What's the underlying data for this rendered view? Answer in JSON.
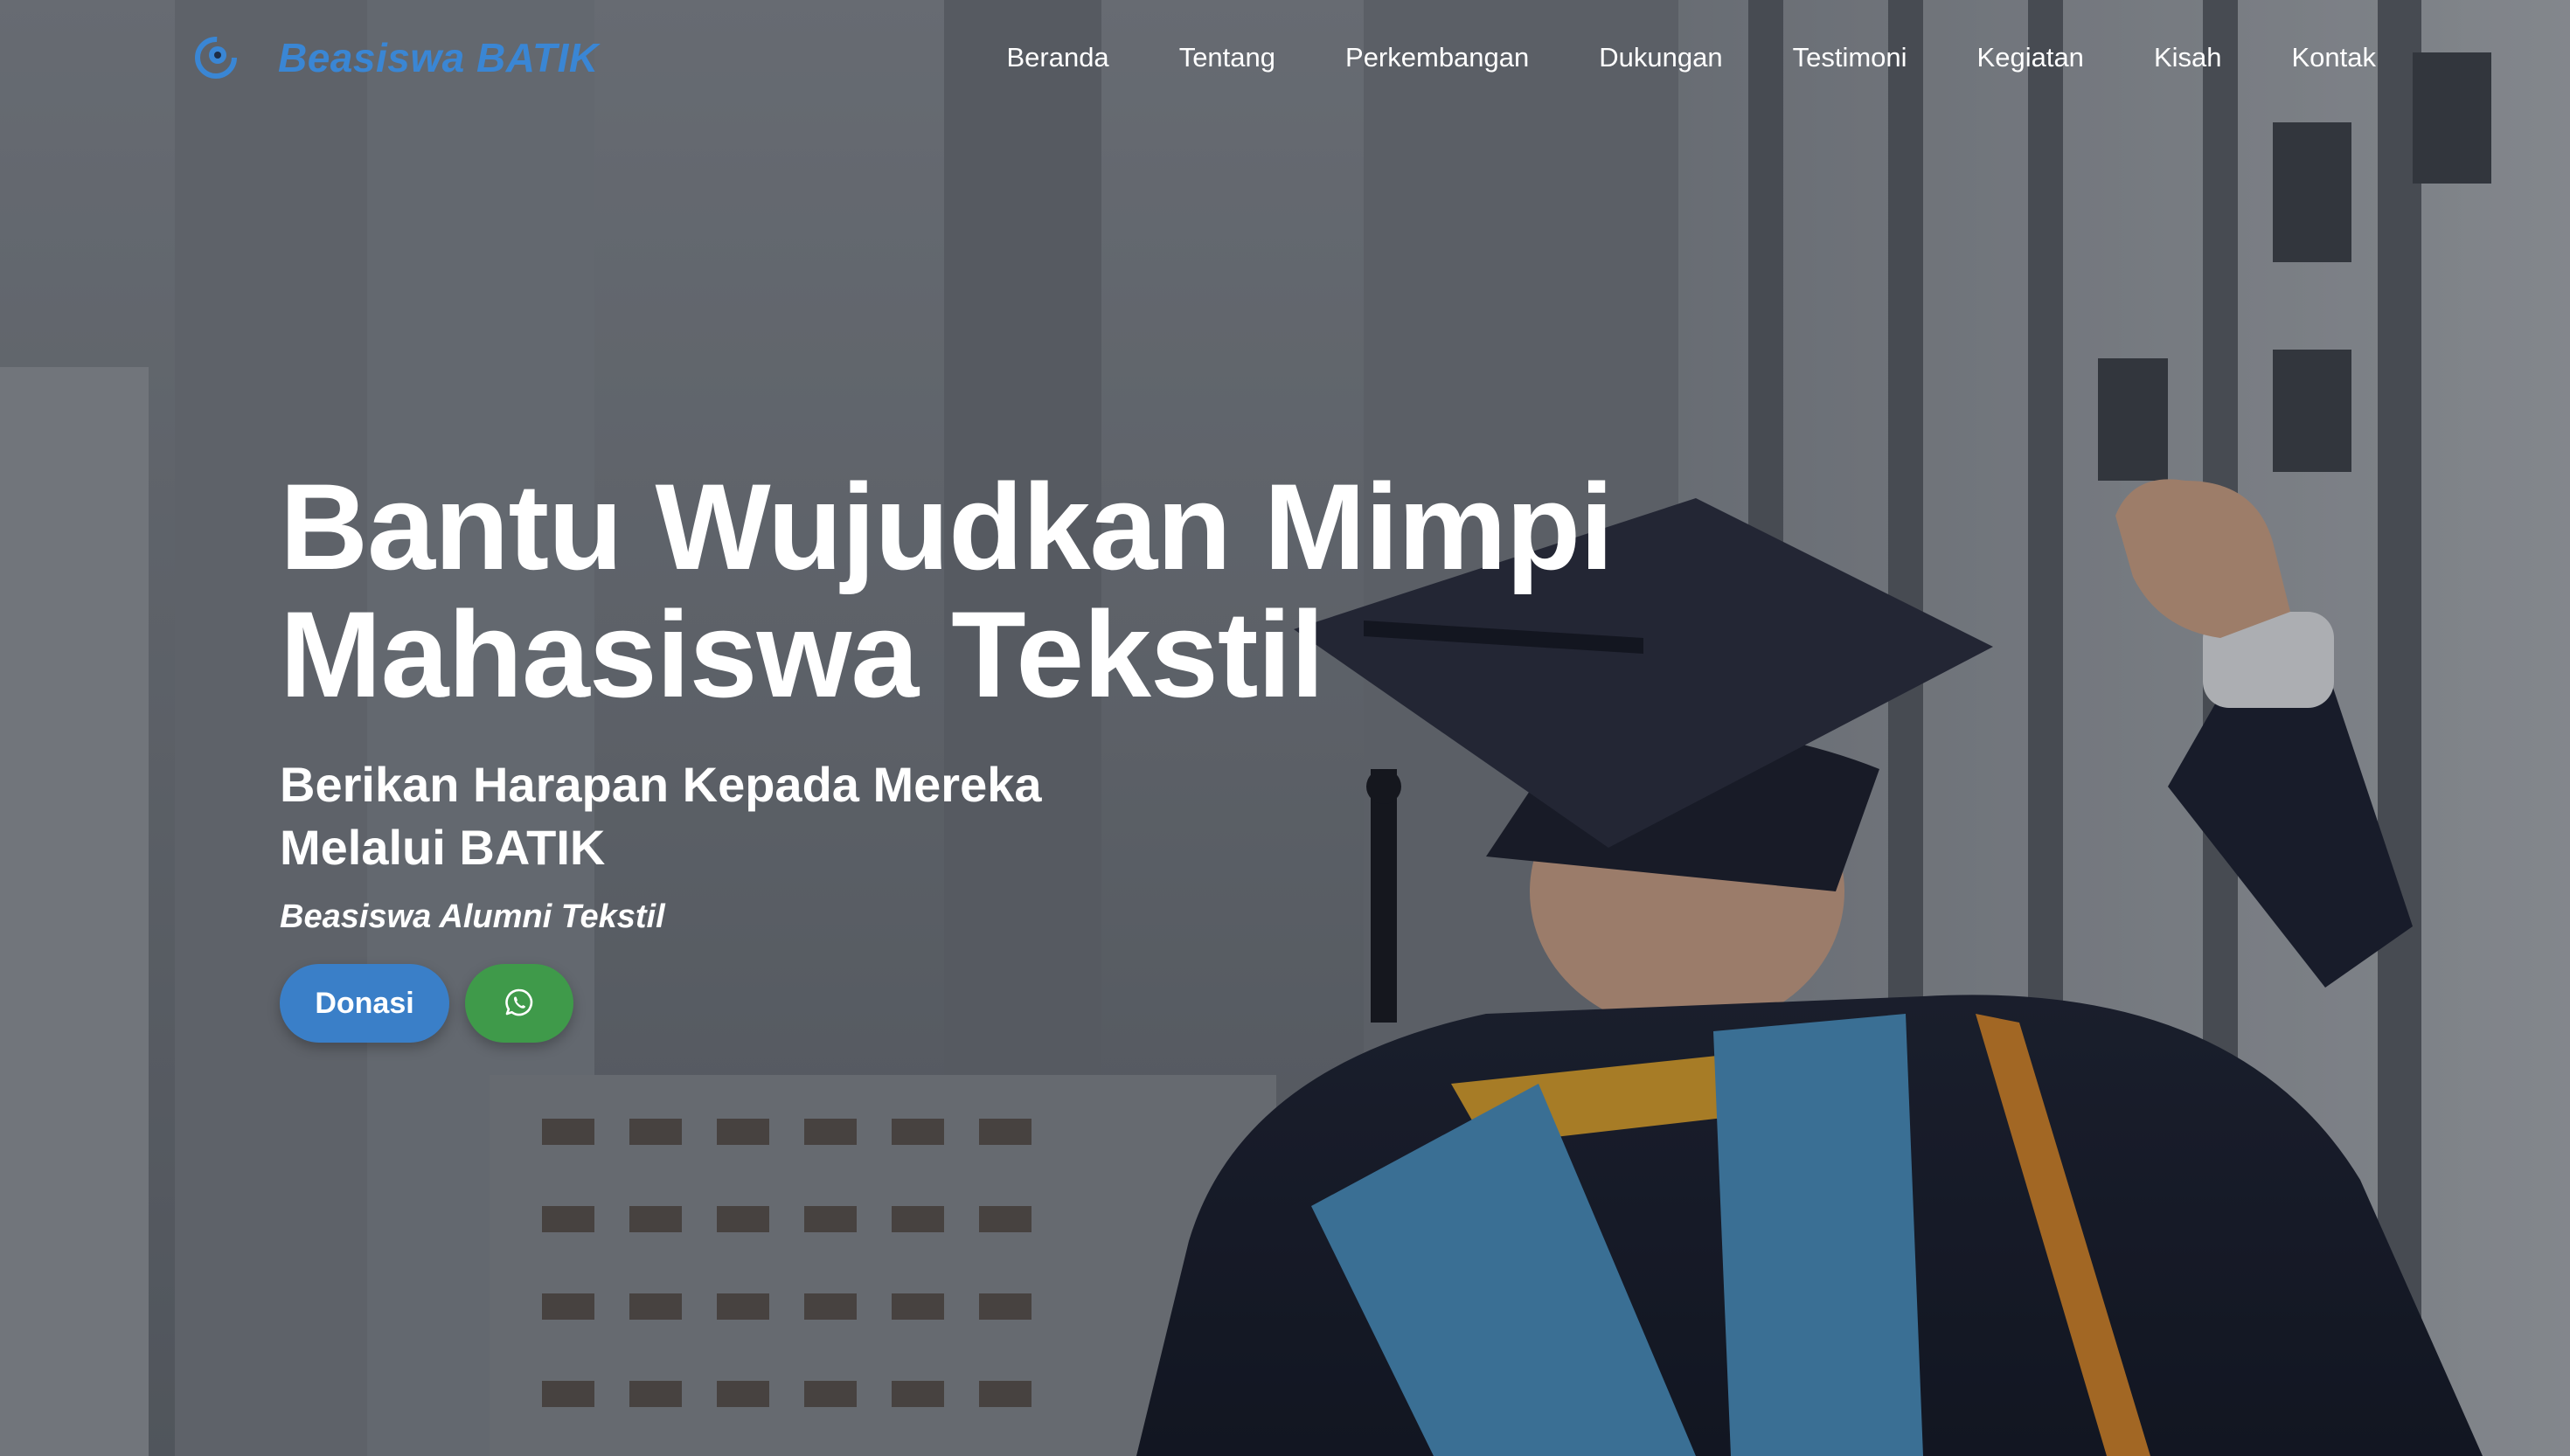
{
  "brand": {
    "name": "Beasiswa BATIK",
    "logo_icon": "batik-logo-icon",
    "color": "#3a86d4"
  },
  "nav": {
    "items": [
      {
        "label": "Beranda"
      },
      {
        "label": "Tentang"
      },
      {
        "label": "Perkembangan"
      },
      {
        "label": "Dukungan"
      },
      {
        "label": "Testimoni"
      },
      {
        "label": "Kegiatan"
      },
      {
        "label": "Kisah"
      },
      {
        "label": "Kontak"
      }
    ]
  },
  "hero": {
    "title_line1": "Bantu Wujudkan Mimpi",
    "title_line2": "Mahasiswa Tekstil",
    "subtitle_line1": "Berikan Harapan Kepada Mereka",
    "subtitle_line2": "Melalui BATIK",
    "tagline": "Beasiswa Alumni Tekstil",
    "background_icon": "graduate-photo"
  },
  "actions": {
    "donate_label": "Donasi",
    "donate_color": "#3a7fc8",
    "whatsapp_icon": "whatsapp-icon",
    "whatsapp_color": "#3f9a4a"
  }
}
